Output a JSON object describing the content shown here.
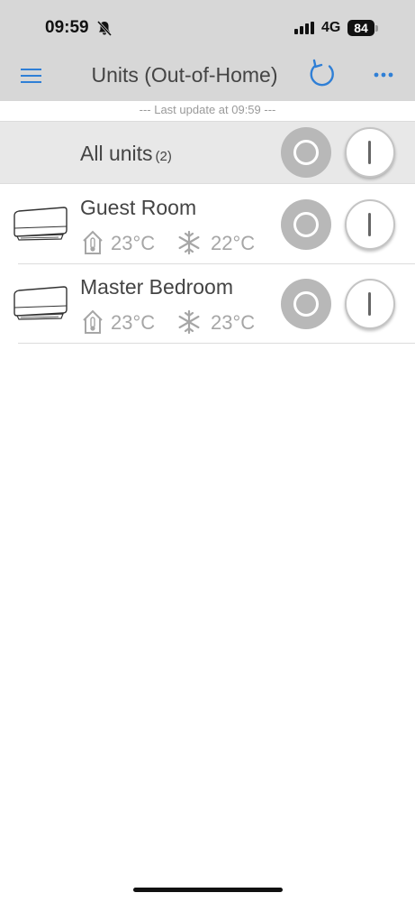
{
  "status_bar": {
    "time": "09:59",
    "network": "4G",
    "battery": "84"
  },
  "header": {
    "title": "Units (Out-of-Home)"
  },
  "last_update": "--- Last update at 09:59 ---",
  "all_units": {
    "label": "All units",
    "count": "(2)"
  },
  "units": [
    {
      "name": "Guest Room",
      "indoor_temp": "23°C",
      "set_temp": "22°C",
      "mode": "cool"
    },
    {
      "name": "Master Bedroom",
      "indoor_temp": "23°C",
      "set_temp": "23°C",
      "mode": "cool"
    }
  ],
  "colors": {
    "accent": "#2f7fd6",
    "header_bg": "#d7d7d7",
    "off_button": "#b8b8b8"
  }
}
